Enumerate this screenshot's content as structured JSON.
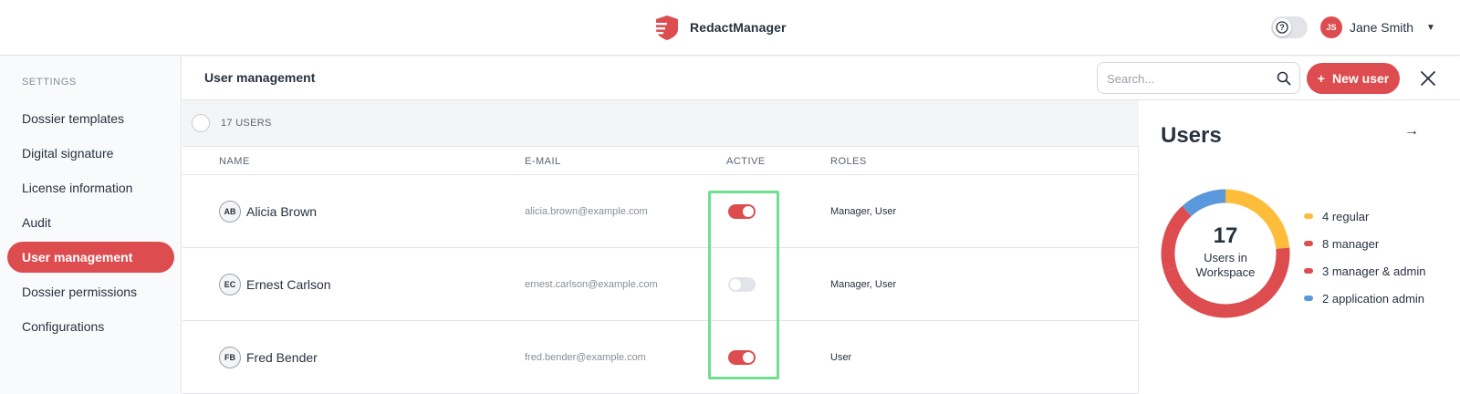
{
  "app": {
    "name": "RedactManager",
    "brand_color": "#dd4d50"
  },
  "user": {
    "initials": "JS",
    "name": "Jane Smith"
  },
  "sidebar": {
    "heading": "SETTINGS",
    "items": [
      {
        "label": "Dossier templates"
      },
      {
        "label": "Digital signature"
      },
      {
        "label": "License information"
      },
      {
        "label": "Audit"
      },
      {
        "label": "User management",
        "active": true
      },
      {
        "label": "Dossier permissions"
      },
      {
        "label": "Configurations"
      }
    ]
  },
  "header": {
    "title": "User management",
    "search_placeholder": "Search...",
    "new_user_label": "New user"
  },
  "table": {
    "count_label": "17 USERS",
    "columns": {
      "name": "NAME",
      "email": "E-MAIL",
      "active": "ACTIVE",
      "roles": "ROLES"
    },
    "rows": [
      {
        "initials": "AB",
        "name": "Alicia Brown",
        "email": "alicia.brown@example.com",
        "active": true,
        "roles": "Manager, User"
      },
      {
        "initials": "EC",
        "name": "Ernest Carlson",
        "email": "ernest.carlson@example.com",
        "active": false,
        "roles": "Manager, User"
      },
      {
        "initials": "FB",
        "name": "Fred Bender",
        "email": "fred.bender@example.com",
        "active": true,
        "roles": "User"
      }
    ]
  },
  "panel": {
    "title": "Users",
    "total": "17",
    "total_label": "Users in Workspace",
    "legend": [
      {
        "label": "4 regular",
        "value": 4,
        "color": "#fdbd3a"
      },
      {
        "label": "8 manager",
        "value": 8,
        "color": "#dd4d50"
      },
      {
        "label": "3 manager & admin",
        "value": 3,
        "color": "#dd4d50"
      },
      {
        "label": "2 application admin",
        "value": 2,
        "color": "#5b97db"
      }
    ]
  },
  "chart_data": {
    "type": "pie",
    "categories": [
      "regular",
      "manager",
      "manager & admin",
      "application admin"
    ],
    "values": [
      4,
      8,
      3,
      2
    ],
    "colors": [
      "#fdbd3a",
      "#dd4d50",
      "#dd4d50",
      "#5b97db"
    ],
    "title": "Users"
  }
}
